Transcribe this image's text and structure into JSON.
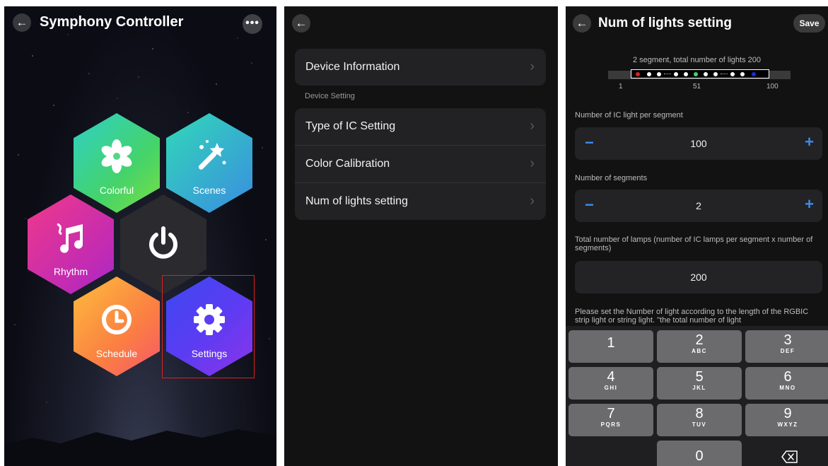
{
  "panel1": {
    "title": "Symphony Controller",
    "back_icon": "←",
    "more_icon": "•••",
    "tiles": {
      "colorful": "Colorful",
      "scenes": "Scenes",
      "rhythm": "Rhythm",
      "schedule": "Schedule",
      "settings": "Settings"
    }
  },
  "panel2": {
    "back_icon": "←",
    "device_information": "Device Information",
    "section_label": "Device Setting",
    "items": [
      "Type of IC Setting",
      "Color Calibration",
      "Num of lights setting"
    ],
    "chevron": "›"
  },
  "panel3": {
    "title": "Num of lights setting",
    "save": "Save",
    "back_icon": "←",
    "segment_caption": "2 segment,  total number of lights 200",
    "segment_dot_colors": [
      "#e02020",
      "#ffffff",
      "#ffffff",
      "#ffffff",
      "#ffffff",
      "#44d36a",
      "#ffffff",
      "#ffffff",
      "#ffffff",
      "#ffffff",
      "#1a2ad8"
    ],
    "ticks": [
      "1",
      "51",
      "100"
    ],
    "ic_label": "Number of IC light per segment",
    "ic_value": "100",
    "segments_label": "Number of segments",
    "segments_value": "2",
    "total_label": "Total number of lamps (number of IC lamps per segment x number of segments)",
    "total_value": "200",
    "help_text": "Please set the Number of light according to the length of the RGBIC strip light or string light. \"the total number of light",
    "minus": "−",
    "plus": "+",
    "keypad": {
      "k1": "1",
      "k2": "2",
      "k2_letters": "ABC",
      "k3": "3",
      "k3_letters": "DEF",
      "k4": "4",
      "k4_letters": "GHI",
      "k5": "5",
      "k5_letters": "JKL",
      "k6": "6",
      "k6_letters": "MNO",
      "k7": "7",
      "k7_letters": "PQRS",
      "k8": "8",
      "k8_letters": "TUV",
      "k9": "9",
      "k9_letters": "WXYZ",
      "k0": "0"
    }
  },
  "colors": {
    "accent_blue": "#3b8cf0",
    "selection_red": "#e02020"
  }
}
